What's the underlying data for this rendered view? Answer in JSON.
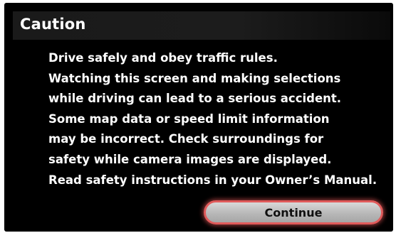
{
  "dialog": {
    "title": "Caution",
    "lines": [
      "Drive safely and obey traffic rules.",
      "Watching this screen and making selections",
      "while driving can lead to a serious accident.",
      "Some map data or speed limit information",
      "may be incorrect. Check surroundings for",
      "safety while camera images are displayed.",
      "Read safety instructions in your Owner’s Manual."
    ],
    "continue_label": "Continue"
  },
  "colors": {
    "background": "#000000",
    "text": "#ffffff",
    "button_highlight": "#e05a5a"
  }
}
